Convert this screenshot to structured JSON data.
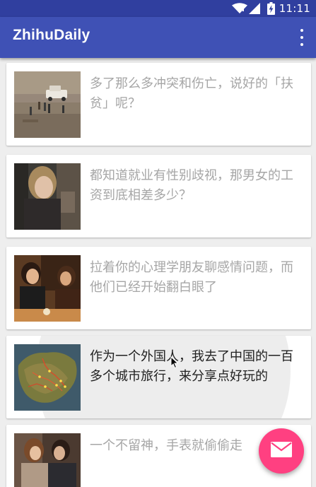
{
  "status_bar": {
    "time": "11:11",
    "icons": [
      "wifi-icon",
      "signal-icon",
      "battery-charging-icon"
    ]
  },
  "app_bar": {
    "title": "ZhihuDaily",
    "menu_icon": "more-vert-icon"
  },
  "stories": [
    {
      "title": "多了那么多冲突和伤亡，说好的「扶贫」呢？",
      "read": true,
      "image": "desert-vehicles-photo"
    },
    {
      "title": "都知道就业有性别歧视，那男女的工资到底相差多少？",
      "read": true,
      "image": "woman-portrait-photo"
    },
    {
      "title": "拉着你的心理学朋友聊感情问题，而他们已经开始翻白眼了",
      "read": true,
      "image": "people-talking-photo"
    },
    {
      "title": "作为一个外国人，我去了中国的一百多个城市旅行，来分享点好玩的",
      "read": false,
      "image": "china-map-photo"
    },
    {
      "title": "一个不留神，手表就偷偷走",
      "read": true,
      "image": "couple-photo"
    }
  ],
  "fab": {
    "icon": "mail-icon"
  },
  "colors": {
    "status_bar": "#303f9f",
    "app_bar": "#3f51b5",
    "accent": "#ff4081",
    "read_text": "#a6a6a6",
    "unread_text": "#212121",
    "background": "#eeeeee"
  }
}
